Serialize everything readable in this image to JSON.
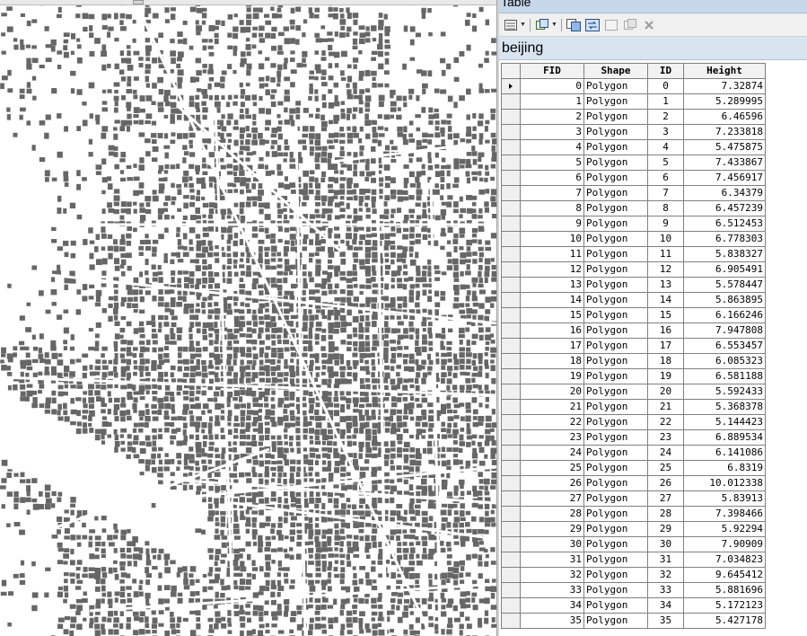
{
  "window": {
    "title": "Table"
  },
  "toolbar": {
    "buttons": [
      {
        "name": "table-options-icon",
        "glyph": "☰"
      },
      {
        "name": "related-tables-icon",
        "glyph": "▤"
      },
      {
        "name": "select-by-attributes-icon",
        "glyph": "▦"
      },
      {
        "name": "switch-selection-icon",
        "glyph": "⇆"
      },
      {
        "name": "clear-selection-icon",
        "glyph": "▢"
      },
      {
        "name": "zoom-to-selected-icon",
        "glyph": "⧉"
      },
      {
        "name": "delete-selected-icon",
        "glyph": "✕"
      }
    ]
  },
  "tab": {
    "label": "beijing"
  },
  "table": {
    "columns": [
      "FID",
      "Shape",
      "ID",
      "Height"
    ],
    "rows": [
      [
        "0",
        "Polygon",
        "0",
        "7.32874"
      ],
      [
        "1",
        "Polygon",
        "1",
        "5.289995"
      ],
      [
        "2",
        "Polygon",
        "2",
        "6.46596"
      ],
      [
        "3",
        "Polygon",
        "3",
        "7.233818"
      ],
      [
        "4",
        "Polygon",
        "4",
        "5.475875"
      ],
      [
        "5",
        "Polygon",
        "5",
        "7.433867"
      ],
      [
        "6",
        "Polygon",
        "6",
        "7.456917"
      ],
      [
        "7",
        "Polygon",
        "7",
        "6.34379"
      ],
      [
        "8",
        "Polygon",
        "8",
        "6.457239"
      ],
      [
        "9",
        "Polygon",
        "9",
        "6.512453"
      ],
      [
        "10",
        "Polygon",
        "10",
        "6.778303"
      ],
      [
        "11",
        "Polygon",
        "11",
        "5.838327"
      ],
      [
        "12",
        "Polygon",
        "12",
        "6.905491"
      ],
      [
        "13",
        "Polygon",
        "13",
        "5.578447"
      ],
      [
        "14",
        "Polygon",
        "14",
        "5.863895"
      ],
      [
        "15",
        "Polygon",
        "15",
        "6.166246"
      ],
      [
        "16",
        "Polygon",
        "16",
        "7.947808"
      ],
      [
        "17",
        "Polygon",
        "17",
        "6.553457"
      ],
      [
        "18",
        "Polygon",
        "18",
        "6.085323"
      ],
      [
        "19",
        "Polygon",
        "19",
        "6.581188"
      ],
      [
        "20",
        "Polygon",
        "20",
        "5.592433"
      ],
      [
        "21",
        "Polygon",
        "21",
        "5.368378"
      ],
      [
        "22",
        "Polygon",
        "22",
        "5.144423"
      ],
      [
        "23",
        "Polygon",
        "23",
        "6.889534"
      ],
      [
        "24",
        "Polygon",
        "24",
        "6.141086"
      ],
      [
        "25",
        "Polygon",
        "25",
        "6.8319"
      ],
      [
        "26",
        "Polygon",
        "26",
        "10.012338"
      ],
      [
        "27",
        "Polygon",
        "27",
        "5.83913"
      ],
      [
        "28",
        "Polygon",
        "28",
        "7.398466"
      ],
      [
        "29",
        "Polygon",
        "29",
        "5.92294"
      ],
      [
        "30",
        "Polygon",
        "30",
        "7.90909"
      ],
      [
        "31",
        "Polygon",
        "31",
        "7.034823"
      ],
      [
        "32",
        "Polygon",
        "32",
        "9.645412"
      ],
      [
        "33",
        "Polygon",
        "33",
        "5.881696"
      ],
      [
        "34",
        "Polygon",
        "34",
        "5.172123"
      ],
      [
        "35",
        "Polygon",
        "35",
        "5.427178"
      ]
    ]
  },
  "colors": {
    "map_fill": "#666666",
    "map_bg": "#ffffff",
    "titlebar": "#c7d7ea",
    "tabbar": "#d9e4f1"
  }
}
